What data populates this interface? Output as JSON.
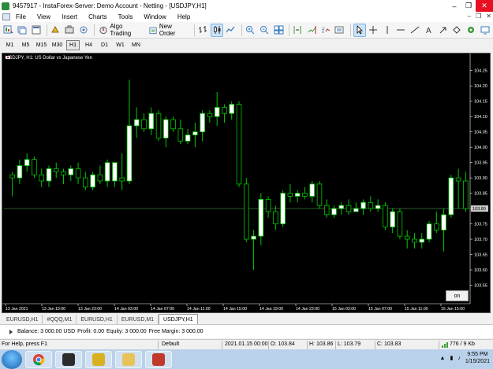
{
  "window": {
    "title": "9457917 - InstaForex-Server: Demo Account - Netting - [USDJPY,H1]",
    "minimize": "–",
    "restore": "❐",
    "close": "✕"
  },
  "menu": {
    "items": [
      "File",
      "View",
      "Insert",
      "Charts",
      "Tools",
      "Window",
      "Help"
    ],
    "right_min": "–",
    "right_restore": "❐",
    "right_close": "✕"
  },
  "toolbar": {
    "algo_trading": "Algo Trading",
    "new_order": "New Order"
  },
  "timeframes": [
    "M1",
    "M5",
    "M15",
    "M30",
    "H1",
    "H4",
    "D1",
    "W1",
    "MN"
  ],
  "active_timeframe": "H1",
  "chart": {
    "title": "USDJPY, H1:  US Dollar vs Japanese Yen",
    "bid_label": "103.80",
    "on_button": "on"
  },
  "chart_data": {
    "type": "candlestick",
    "symbol": "USDJPY",
    "timeframe": "H1",
    "ylim": [
      103.5,
      104.28
    ],
    "y_ticks": [
      "104.25",
      "104.20",
      "104.15",
      "104.10",
      "104.05",
      "104.00",
      "103.95",
      "103.90",
      "103.85",
      "103.80",
      "103.75",
      "103.70",
      "103.65",
      "103.60",
      "103.55"
    ],
    "x_ticks": [
      "13 Jan 2021",
      "13 Jan 19:00",
      "13 Jan 23:00",
      "14 Jan 03:00",
      "14 Jan 07:00",
      "14 Jan 11:00",
      "14 Jan 15:00",
      "14 Jan 19:00",
      "14 Jan 23:00",
      "15 Jan 03:00",
      "15 Jan 07:00",
      "15 Jan 11:00",
      "15 Jan 15:00"
    ],
    "bid": 103.8,
    "candles": [
      [
        103.91,
        103.92,
        103.84,
        103.9
      ],
      [
        103.9,
        103.96,
        103.88,
        103.94
      ],
      [
        103.94,
        103.98,
        103.92,
        103.96
      ],
      [
        103.96,
        103.97,
        103.9,
        103.91
      ],
      [
        103.91,
        103.93,
        103.87,
        103.89
      ],
      [
        103.89,
        103.94,
        103.87,
        103.93
      ],
      [
        103.93,
        103.95,
        103.9,
        103.92
      ],
      [
        103.92,
        103.93,
        103.88,
        103.91
      ],
      [
        103.91,
        103.94,
        103.89,
        103.93
      ],
      [
        103.93,
        103.95,
        103.88,
        103.9
      ],
      [
        103.9,
        103.92,
        103.86,
        103.87
      ],
      [
        103.87,
        103.92,
        103.86,
        103.91
      ],
      [
        103.91,
        103.94,
        103.88,
        103.89
      ],
      [
        103.89,
        103.96,
        103.87,
        103.95
      ],
      [
        103.89,
        103.95,
        103.87,
        103.95
      ],
      [
        103.9,
        103.98,
        103.86,
        103.89
      ],
      [
        103.89,
        104.22,
        103.88,
        104.07
      ],
      [
        104.07,
        104.13,
        104.03,
        104.09
      ],
      [
        104.09,
        104.11,
        104.05,
        104.06
      ],
      [
        104.06,
        104.13,
        104.04,
        104.11
      ],
      [
        104.11,
        104.12,
        104.02,
        104.03
      ],
      [
        104.03,
        104.1,
        104.0,
        104.09
      ],
      [
        104.09,
        104.1,
        104.05,
        104.06
      ],
      [
        104.06,
        104.09,
        104.01,
        104.02
      ],
      [
        104.02,
        104.06,
        104.01,
        104.04
      ],
      [
        104.04,
        104.08,
        104.0,
        104.05
      ],
      [
        104.05,
        104.12,
        104.02,
        104.11
      ],
      [
        104.11,
        104.12,
        104.08,
        104.1
      ],
      [
        104.1,
        104.18,
        104.07,
        104.13
      ],
      [
        104.13,
        104.14,
        104.08,
        104.11
      ],
      [
        104.11,
        104.15,
        104.09,
        104.14
      ],
      [
        104.14,
        104.15,
        103.87,
        103.88
      ],
      [
        103.88,
        103.9,
        103.69,
        103.7
      ],
      [
        103.7,
        103.73,
        103.6,
        103.71
      ],
      [
        103.71,
        103.85,
        103.68,
        103.83
      ],
      [
        103.83,
        103.84,
        103.77,
        103.79
      ],
      [
        103.79,
        103.81,
        103.73,
        103.75
      ],
      [
        103.75,
        103.86,
        103.74,
        103.85
      ],
      [
        103.85,
        103.88,
        103.82,
        103.84
      ],
      [
        103.84,
        103.86,
        103.82,
        103.85
      ],
      [
        103.85,
        103.87,
        103.83,
        103.84
      ],
      [
        103.84,
        103.89,
        103.82,
        103.88
      ],
      [
        103.88,
        103.89,
        103.8,
        103.81
      ],
      [
        103.81,
        103.83,
        103.77,
        103.78
      ],
      [
        103.78,
        103.81,
        103.77,
        103.8
      ],
      [
        103.8,
        103.82,
        103.78,
        103.81
      ],
      [
        103.81,
        103.83,
        103.78,
        103.79
      ],
      [
        103.79,
        103.82,
        103.79,
        103.8
      ],
      [
        103.8,
        103.83,
        103.78,
        103.82
      ],
      [
        103.82,
        103.84,
        103.79,
        103.8
      ],
      [
        103.8,
        103.83,
        103.79,
        103.81
      ],
      [
        103.81,
        103.82,
        103.73,
        103.74
      ],
      [
        103.74,
        103.8,
        103.72,
        103.79
      ],
      [
        103.79,
        103.8,
        103.7,
        103.71
      ],
      [
        103.71,
        103.73,
        103.67,
        103.7
      ],
      [
        103.7,
        103.72,
        103.67,
        103.69
      ],
      [
        103.69,
        103.72,
        103.67,
        103.7
      ],
      [
        103.7,
        103.76,
        103.69,
        103.75
      ],
      [
        103.75,
        103.79,
        103.72,
        103.73
      ],
      [
        103.73,
        103.8,
        103.66,
        103.78
      ],
      [
        103.78,
        103.91,
        103.77,
        103.9
      ],
      [
        103.9,
        103.93,
        103.8,
        103.89
      ],
      [
        103.89,
        103.92,
        103.79,
        103.8
      ]
    ]
  },
  "symbol_tabs": [
    "EURUSD,H1",
    "#QQQ,M1",
    "EURUSD,H1",
    "EURUSD,M1",
    "USDJPY,H1"
  ],
  "active_symbol_tab": 4,
  "balance": {
    "balance": "Balance: 3 000.00 USD",
    "profit": "Profit: 0.00",
    "equity": "Equity: 3 000.00",
    "free_margin": "Free Margin: 3 000.00"
  },
  "status": {
    "help": "For Help, press F1",
    "profile": "Default",
    "datetime": "2021.01.15 00:00",
    "open": "O: 103.84",
    "high": "H: 103.86",
    "low": "L: 103.79",
    "close": "C: 103.83",
    "traffic": "776 / 9 Kb"
  },
  "taskbar": {
    "time": "9:55 PM",
    "date": "1/15/2021"
  },
  "colors": {
    "candle_up": "#ffffff",
    "candle_down": "#000000",
    "wick": "#00c800",
    "chart_bg": "#000000",
    "grid_line": "#2f6b2f"
  }
}
